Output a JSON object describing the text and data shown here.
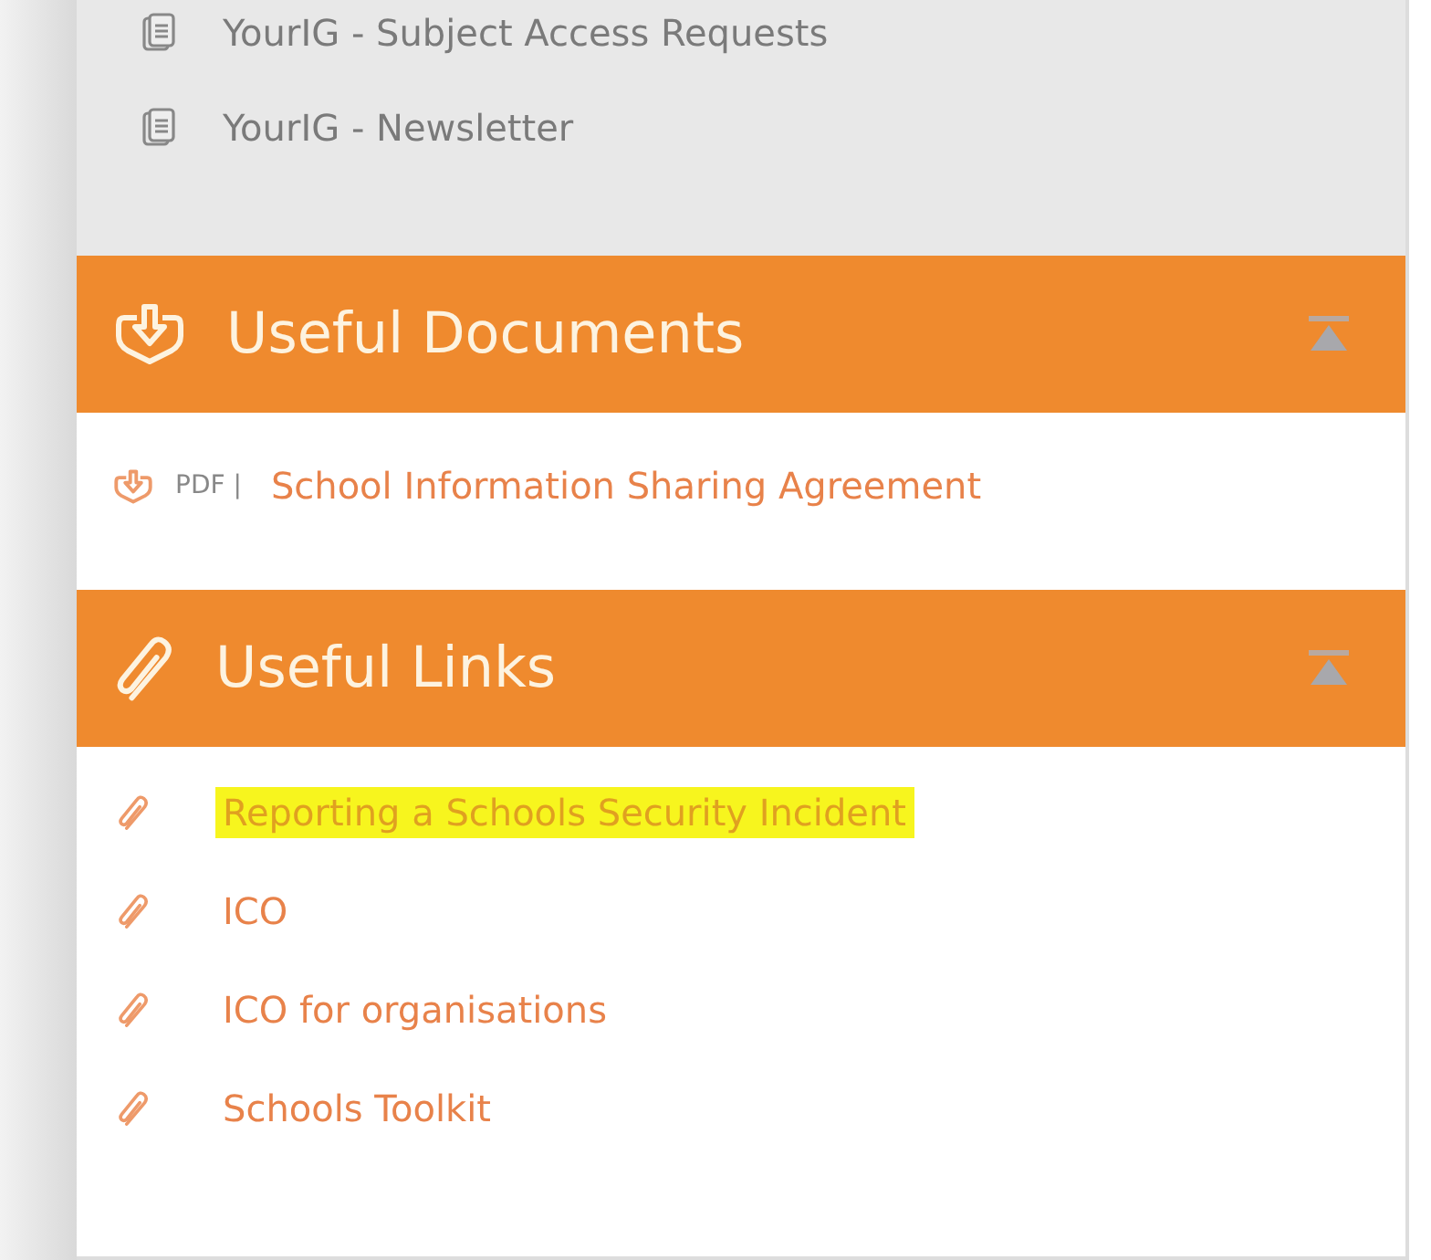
{
  "document_list": {
    "items": [
      {
        "label": "YourIG - Subject Access Requests"
      },
      {
        "label": "YourIG - Newsletter"
      }
    ]
  },
  "sections": [
    {
      "kind": "documents",
      "title": "Useful Documents",
      "items": [
        {
          "tag": "PDF |",
          "label": "School Information Sharing Agreement",
          "highlighted": false
        }
      ]
    },
    {
      "kind": "links",
      "title": "Useful Links",
      "items": [
        {
          "label": "Reporting a Schools Security Incident",
          "highlighted": true
        },
        {
          "label": "ICO",
          "highlighted": false
        },
        {
          "label": "ICO for organisations",
          "highlighted": false
        },
        {
          "label": "Schools Toolkit",
          "highlighted": false
        }
      ]
    }
  ]
}
